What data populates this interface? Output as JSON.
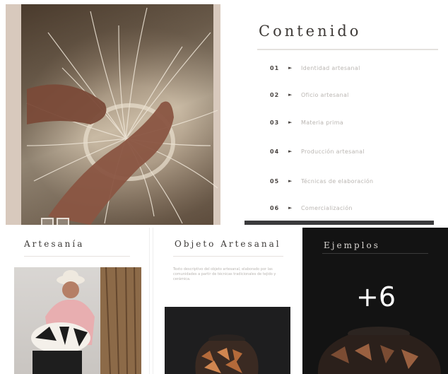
{
  "contents": {
    "title": "Contenido",
    "items": [
      {
        "num": "01",
        "label": "Identidad artesanal"
      },
      {
        "num": "02",
        "label": "Oficio artesanal"
      },
      {
        "num": "03",
        "label": "Materia prima"
      },
      {
        "num": "04",
        "label": "Producción artesanal"
      },
      {
        "num": "05",
        "label": "Técnicas de elaboración"
      },
      {
        "num": "06",
        "label": "Comercialización"
      }
    ]
  },
  "cards": {
    "artisan": {
      "title": "Artesanía"
    },
    "object": {
      "title": "Objeto Artesanal",
      "description": "Texto descriptivo del objeto artesanal, elaborado por las comunidades a partir de técnicas tradicionales de tejido y cerámica."
    },
    "examples": {
      "title": "Ejemplos",
      "count": "+6"
    }
  },
  "colors": {
    "heading": "#3e3a37",
    "rule": "#e4e1de",
    "dark_card": "#131313",
    "weave_bg": "#d8c9bd"
  }
}
